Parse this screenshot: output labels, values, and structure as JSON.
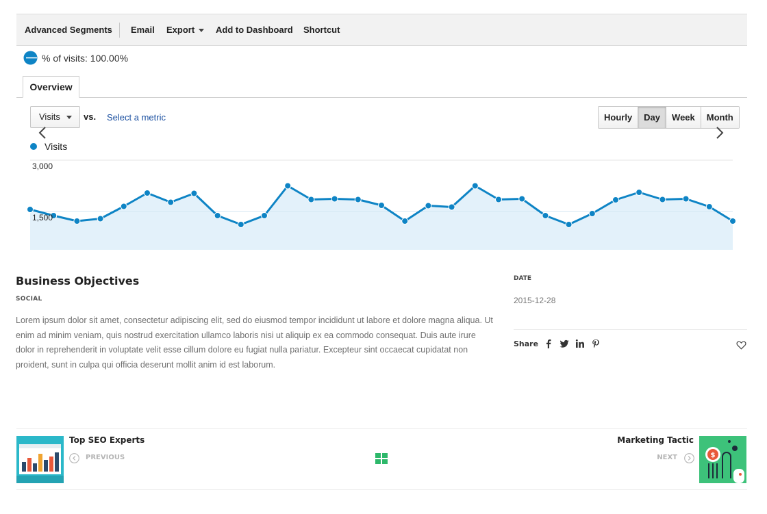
{
  "toolbar": {
    "items": [
      "Advanced Segments",
      "Email",
      "Export",
      "Add to Dashboard",
      "Shortcut"
    ]
  },
  "segment": {
    "text": "% of visits: 100.00%",
    "percent": 100
  },
  "tabs": [
    "Overview"
  ],
  "controls": {
    "metric": "Visits",
    "vs": "vs.",
    "select_metric": "Select a metric",
    "periods": [
      "Hourly",
      "Day",
      "Week",
      "Month"
    ],
    "active_period": "Day"
  },
  "chart_data": {
    "type": "area",
    "series": [
      {
        "name": "Visits",
        "values": [
          1560,
          1380,
          1220,
          1290,
          1650,
          2040,
          1770,
          2030,
          1380,
          1120,
          1380,
          2250,
          1850,
          1870,
          1850,
          1680,
          1220,
          1670,
          1630,
          2250,
          1850,
          1870,
          1380,
          1120,
          1440,
          1840,
          2060,
          1850,
          1870,
          1640,
          1220
        ]
      }
    ],
    "y_ticks": [
      "3,000",
      "1,500"
    ],
    "ylim": [
      0,
      3000
    ],
    "colors": {
      "line": "#0e84c5",
      "fill": "#e3f1fa"
    }
  },
  "post": {
    "title": "Business Objectives",
    "category": "SOCIAL",
    "body": "Lorem ipsum dolor sit amet, consectetur adipiscing elit, sed do eiusmod tempor incididunt ut labore et dolore magna aliqua. Ut enim ad minim veniam, quis nostrud exercitation ullamco laboris nisi ut aliquip ex ea commodo consequat. Duis aute irure dolor in reprehenderit in voluptate velit esse cillum dolore eu fugiat nulla pariatur. Excepteur sint occaecat cupidatat non proident, sunt in culpa qui officia deserunt mollit anim id est laborum."
  },
  "meta": {
    "date_label": "DATE",
    "date_value": "2015-12-28",
    "share_label": "Share",
    "share_icons": [
      "facebook-icon",
      "twitter-icon",
      "linkedin-icon",
      "pinterest-icon"
    ]
  },
  "post_nav": {
    "prev_title": "Top SEO Experts",
    "prev_label": "PREVIOUS",
    "next_title": "Marketing Tactic",
    "next_label": "NEXT"
  },
  "colors": {
    "accent": "#0e84c5",
    "link": "#1a4fa0",
    "grid_icon": "#2db86a",
    "prev_thumb": "#2bb8c9",
    "next_thumb": "#3dc27a"
  }
}
